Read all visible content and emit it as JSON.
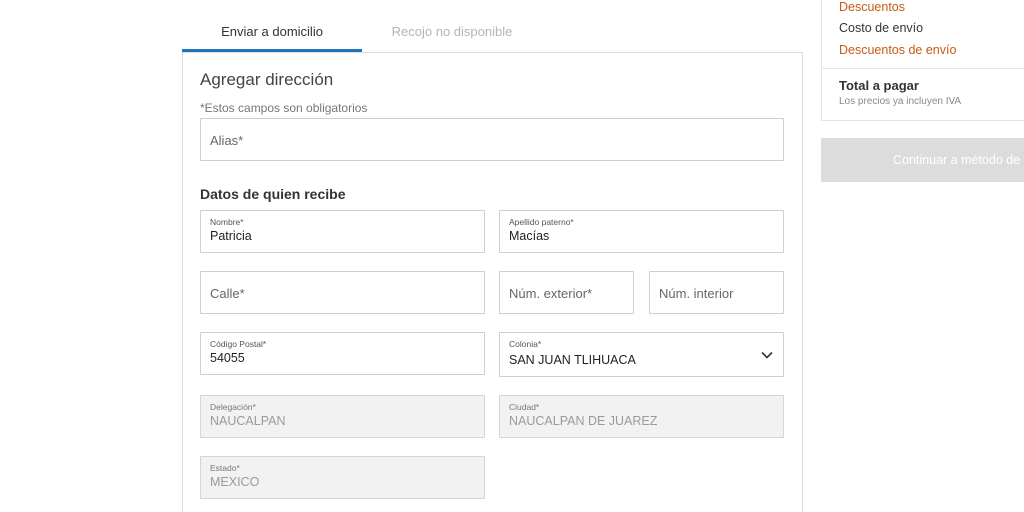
{
  "tabs": {
    "delivery": "Enviar a domicilio",
    "pickup": "Recojo no disponible"
  },
  "form": {
    "title": "Agregar dirección",
    "required_note": "*Estos campos son obligatorios",
    "alias_placeholder": "Alias*",
    "recipient_title": "Datos de quien recibe",
    "nombre": {
      "label": "Nombre*",
      "value": "Patricia"
    },
    "apellido": {
      "label": "Apellido paterno*",
      "value": "Macías"
    },
    "calle_placeholder": "Calle*",
    "num_exterior_placeholder": "Núm. exterior*",
    "num_interior_placeholder": "Núm. interior",
    "codigo_postal": {
      "label": "Código Postal*",
      "value": "54055"
    },
    "colonia": {
      "label": "Colonia*",
      "value": "SAN JUAN TLIHUACA"
    },
    "delegacion": {
      "label": "Delegación*",
      "value": "NAUCALPAN"
    },
    "ciudad": {
      "label": "Ciudad*",
      "value": "NAUCALPAN DE JUAREZ"
    },
    "estado": {
      "label": "Estado*",
      "value": "MEXICO"
    }
  },
  "summary": {
    "descuentos": "Descuentos",
    "costo_envio": "Costo de envío",
    "descuentos_envio": "Descuentos de envío",
    "total_label": "Total a pagar",
    "iva_note": "Los precios ya incluyen IVA",
    "continue_label": "Continuar a método de p"
  },
  "colors": {
    "accent_blue": "#1e73be",
    "discount_orange": "#c85a14",
    "disabled_button": "#dcdcdc"
  },
  "icons": {
    "colonia_dropdown": "chevron-down-icon"
  }
}
